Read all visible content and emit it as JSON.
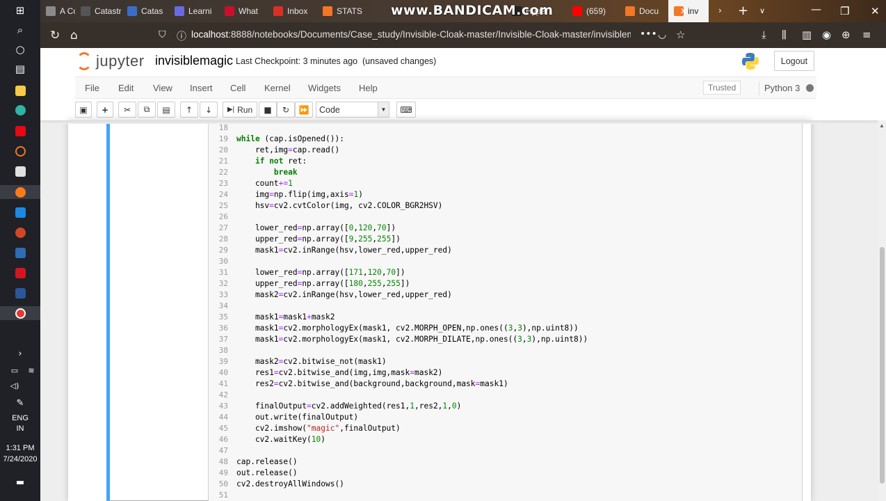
{
  "taskbar": {
    "icons": [
      "windows-icon",
      "search-icon",
      "cortana-icon",
      "task-view-icon",
      "file-explorer-icon",
      "edge-icon",
      "netflix-icon",
      "jupyter-app-icon",
      "store-icon",
      "firefox-icon",
      "mail-icon",
      "powerpoint-icon",
      "hyperv-icon",
      "acrobat-icon",
      "word-icon",
      "bandicam-icon"
    ],
    "language": "ENG",
    "region": "IN",
    "time": "1:31 PM",
    "date": "7/24/2020"
  },
  "browser": {
    "tabs": [
      {
        "label": "A Cor",
        "color": "#8a8a8a"
      },
      {
        "label": "Catastroph",
        "color": "#555555"
      },
      {
        "label": "Catas",
        "color": "#3c6dc8"
      },
      {
        "label": "Learni",
        "color": "#6a6ae0"
      },
      {
        "label": "What",
        "color": "#c8102e"
      },
      {
        "label": "Inbox",
        "color": "#d93025"
      },
      {
        "label": "STATS",
        "color": "#f37726"
      },
      {
        "label": "Hyper",
        "color": "#222222"
      },
      {
        "label": "(659)",
        "color": "#ff0000"
      },
      {
        "label": "Docu",
        "color": "#f37726"
      },
      {
        "label": "inv",
        "color": "#f37726"
      }
    ],
    "watermark": "www.BANDICAM.com",
    "url_host": "localhost",
    "url_path": ":8888/notebooks/Documents/Case_study/Invisible-Cloak-master/Invisible-Cloak-master/invisiblemag"
  },
  "jupyter": {
    "logo_text": "jupyter",
    "notebook_name": "invisiblemagic",
    "checkpoint": "Last Checkpoint: 3 minutes ago",
    "unsaved": "(unsaved changes)",
    "logout": "Logout",
    "menu": [
      "File",
      "Edit",
      "View",
      "Insert",
      "Cell",
      "Kernel",
      "Widgets",
      "Help"
    ],
    "trusted": "Trusted",
    "kernel_name": "Python 3",
    "run_label": "Run",
    "cell_type": "Code"
  },
  "code": {
    "first_line_number": 18,
    "lines": [
      "",
      "while (cap.isOpened()):",
      "    ret,img=cap.read()",
      "    if not ret:",
      "        break",
      "    count+=1",
      "    img=np.flip(img,axis=1)",
      "    hsv=cv2.cvtColor(img, cv2.COLOR_BGR2HSV)",
      "",
      "    lower_red=np.array([0,120,70])",
      "    upper_red=np.array([9,255,255])",
      "    mask1=cv2.inRange(hsv,lower_red,upper_red)",
      "",
      "    lower_red=np.array([171,120,70])",
      "    upper_red=np.array([180,255,255])",
      "    mask2=cv2.inRange(hsv,lower_red,upper_red)",
      "",
      "    mask1=mask1+mask2",
      "    mask1=cv2.morphologyEx(mask1, cv2.MORPH_OPEN,np.ones((3,3),np.uint8))",
      "    mask1=cv2.morphologyEx(mask1, cv2.MORPH_DILATE,np.ones((3,3),np.uint8))",
      "",
      "    mask2=cv2.bitwise_not(mask1)",
      "    res1=cv2.bitwise_and(img,img,mask=mask2)",
      "    res2=cv2.bitwise_and(background,background,mask=mask1)",
      "",
      "    finalOutput=cv2.addWeighted(res1,1,res2,1,0)",
      "    out.write(finalOutput)",
      "    cv2.imshow(\"magic\",finalOutput)",
      "    cv2.waitKey(10)",
      "",
      "cap.release()",
      "out.release()",
      "cv2.destroyAllWindows()",
      ""
    ]
  },
  "colors": {
    "accent_selected_cell": "#42a5f5",
    "jupyter_orange": "#f37726",
    "keyword": "#008000",
    "operator": "#aa22ff",
    "string": "#ba2121"
  }
}
